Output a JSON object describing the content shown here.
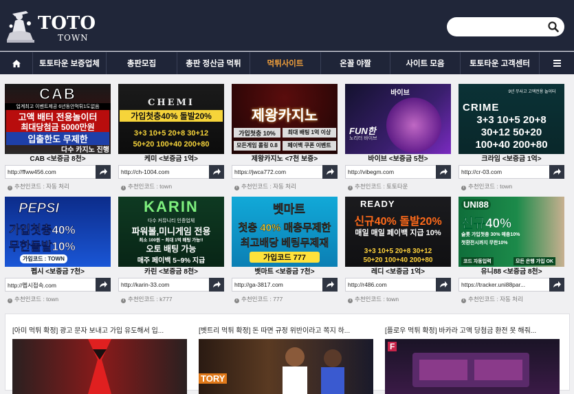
{
  "header": {
    "logo_title": "TOTO",
    "logo_sub": "TOWN",
    "search_placeholder": ""
  },
  "nav": {
    "items": [
      {
        "label": "",
        "icon": "home-icon"
      },
      {
        "label": "토토타운 보증업체"
      },
      {
        "label": "총판모집"
      },
      {
        "label": "총판 정산금 먹튀"
      },
      {
        "label": "먹튀사이트",
        "active": true
      },
      {
        "label": "온꼴 야짤"
      },
      {
        "label": "사이트 모음"
      },
      {
        "label": "토토타운 고객센터"
      },
      {
        "label": "",
        "icon": "menu-icon"
      }
    ]
  },
  "sites": [
    {
      "name": "CAB <보증금 8천>",
      "url": "http://ffww456.com",
      "rec": "추천인코드 : 자동 처리",
      "banner": {
        "brand": "CAB",
        "lines": [
          "업계최고 이벤트제공 6년동안먹튀1도없음",
          "고액 배터 전용놀이터",
          "최대당첨금 5000만원",
          "입출한도 무제한",
          "다수 카지노 진행"
        ]
      }
    },
    {
      "name": "케미 <보증금 1억>",
      "url": "http://ch-1004.com",
      "rec": "추천인코드 : town",
      "banner": {
        "brand": "CHEMI",
        "lines": [
          "가입첫충40% 돌발20%",
          "3+3 10+5 20+8 30+12",
          "50+20 100+40 200+80"
        ]
      }
    },
    {
      "name": "제왕카지노 <7천 보증>",
      "url": "https://jwca772.com",
      "rec": "추천인코드 : 자동 처리",
      "banner": {
        "brand": "제왕카지노",
        "lines": [
          "가입첫충 10%",
          "최대 배팅 1억 이상",
          "모든게임 롤링 0.8",
          "페이백 쿠폰 이벤트"
        ]
      }
    },
    {
      "name": "바이브 <보증금 5천>",
      "url": "http://vibegm.com",
      "rec": "추천인코드 : 토토타운",
      "banner": {
        "brand": "바이브",
        "lines": [
          "FUN한",
          "노리터 바이브"
        ]
      }
    },
    {
      "name": "크라임 <보증금 1억>",
      "url": "http://cr-03.com",
      "rec": "추천인코드 : town",
      "banner": {
        "brand": "CRIME",
        "lines": [
          "9년 무사고 고액전용 놀이터",
          "3+3 10+5 20+8",
          "30+12 50+20",
          "100+40 200+80"
        ]
      }
    },
    {
      "name": "펩시 <보증금 7천>",
      "url": "http://펩시접속.com",
      "rec": "추천인코드 : town",
      "banner": {
        "brand": "PEPSI",
        "lines": [
          "가입첫충40%",
          "무한돌발10%",
          "가입코드 : TOWN"
        ]
      }
    },
    {
      "name": "카린 <보증금 8천>",
      "url": "http://karin-33.com",
      "rec": "추천인코드 : k777",
      "banner": {
        "brand": "KARIN",
        "lines": [
          "다수 커뮤니티 인증업체",
          "파워볼,미니게임 전용",
          "최소 100원 ~ 최대 1억 배팅 가능!!",
          "오토 배팅 가능",
          "매주 페이백 5~9% 지급"
        ]
      }
    },
    {
      "name": "벳마트 <보증금 7천>",
      "url": "http://ga-3817.com",
      "rec": "추천인코드 : 777",
      "banner": {
        "brand": "벳마트",
        "lines": [
          "첫충 40% 매충무제한",
          "최고배당 베팅무제재",
          "가입코드 777"
        ]
      }
    },
    {
      "name": "레디 <보증금 1억>",
      "url": "http://r486.com",
      "rec": "추천인코드 : town",
      "banner": {
        "brand": "READY",
        "lines": [
          "신규40% 돌발20%",
          "매일 매일 페이백 지급 10%",
          "3+3 10+5 20+8 30+12",
          "50+20 100+40 200+80"
        ]
      }
    },
    {
      "name": "유니88 <보증금 8천>",
      "url": "https://tracker.uni88par...",
      "rec": "추천인코드 : 자동 처리",
      "banner": {
        "brand": "UNI88",
        "lines": [
          "신규40%",
          "슬롯 가입첫충 30% 매충10%",
          "첫환전시까지 무한10%",
          "코드 자동입력",
          "모든 은행 가입 OK"
        ]
      }
    }
  ],
  "posts": [
    {
      "title": "[아미 먹튀 확정] 광고 문자 보내고 가입 유도해서 입..."
    },
    {
      "title": "[벳트리 먹튀 확정] 돈 따면 규정 위반이라고 쪽지 하..."
    },
    {
      "title": "[플로우 먹튀 확정] 바카라 고액 당첨금 환전 못 해줘..."
    }
  ],
  "post_image_texts": [
    "",
    "TORY",
    "F"
  ],
  "colors": {
    "header_bg": "#202639",
    "nav_active": "#f2a03b",
    "share_btn": "#2f3542"
  }
}
